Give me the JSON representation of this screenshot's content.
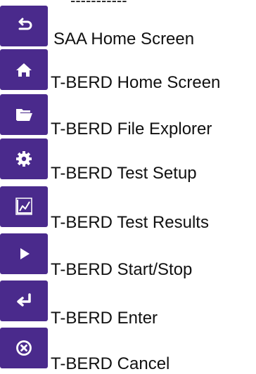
{
  "theme": {
    "accent": "#4a2a8c",
    "icon": "#ffffff",
    "text": "#111111"
  },
  "header_fragment": "-----------",
  "items": [
    {
      "icon": "return-icon",
      "label": "SAA Home Screen"
    },
    {
      "icon": "home-icon",
      "label": "T-BERD Home Screen"
    },
    {
      "icon": "folder-icon",
      "label": "T-BERD File Explorer"
    },
    {
      "icon": "gear-icon",
      "label": "T-BERD Test Setup"
    },
    {
      "icon": "chart-icon",
      "label": "T-BERD Test Results"
    },
    {
      "icon": "play-icon",
      "label": "T-BERD Start/Stop"
    },
    {
      "icon": "enter-icon",
      "label": "T-BERD Enter"
    },
    {
      "icon": "cancel-icon",
      "label": "T-BERD Cancel"
    }
  ]
}
